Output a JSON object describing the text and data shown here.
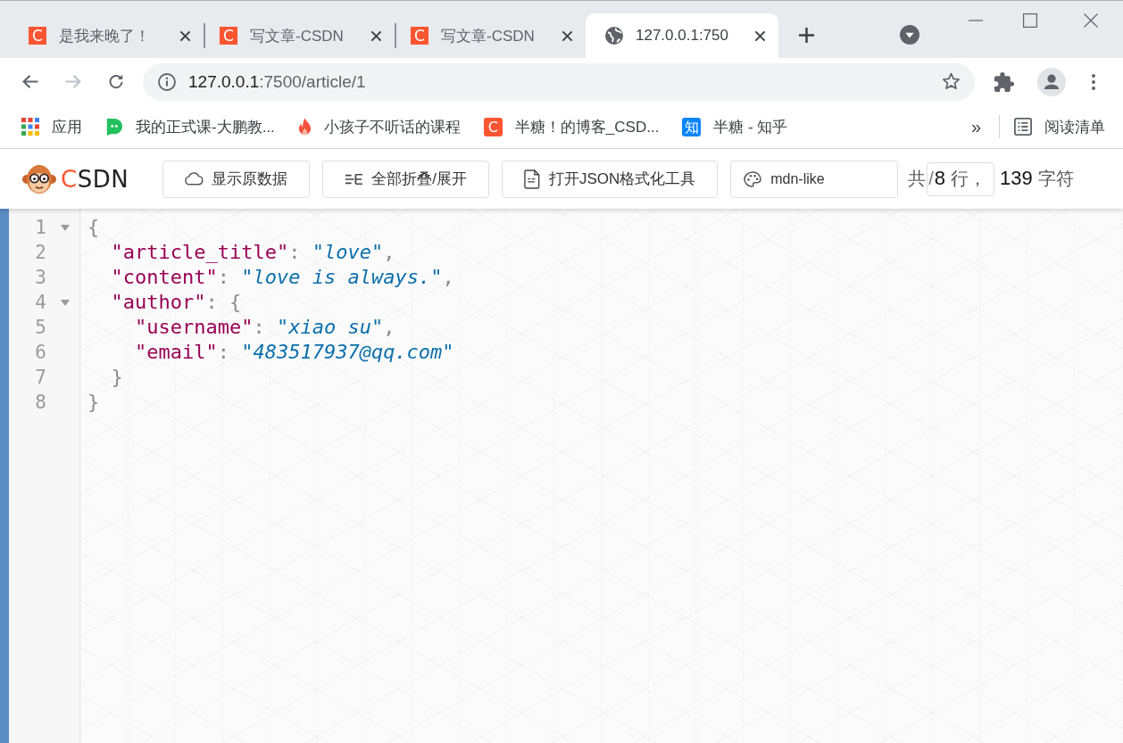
{
  "tabs": [
    {
      "title": "是我来晚了！",
      "kind": "letter",
      "icon_text": "C",
      "color": "#fc5531",
      "selected": false
    },
    {
      "title": "写文章-CSDN",
      "kind": "letter",
      "icon_text": "C",
      "color": "#fc5531",
      "selected": false
    },
    {
      "title": "写文章-CSDN",
      "kind": "letter",
      "icon_text": "C",
      "color": "#fc5531",
      "selected": false
    },
    {
      "title": "127.0.0.1:750",
      "kind": "globe",
      "selected": true
    }
  ],
  "nav_buttons": [
    {
      "kind": "back",
      "disabled": false
    },
    {
      "kind": "forward",
      "disabled": true
    },
    {
      "kind": "reload",
      "disabled": false
    }
  ],
  "address_bar": {
    "host": "127.0.0.1",
    "path": ":7500/article/1"
  },
  "bookmarks": [
    {
      "label": "应用",
      "kind": "apps"
    },
    {
      "label": "我的正式课-大鹏教...",
      "kind": "chat"
    },
    {
      "label": "小孩子不听话的课程",
      "kind": "flame"
    },
    {
      "label": "半糖！的博客_CSD...",
      "kind": "letter",
      "icon_text": "C",
      "color": "#fc5531"
    },
    {
      "label": "半糖 - 知乎",
      "kind": "letter",
      "icon_text": "知",
      "color": "#0b84ff"
    }
  ],
  "bookmarks_overflow": "»",
  "reading_list": {
    "label": "阅读清单"
  },
  "json_viewer": {
    "logo_text": "CSDN",
    "buttons": [
      {
        "label": "显示原数据",
        "kind": "cloud"
      },
      {
        "label": "全部折叠/展开",
        "kind": "lines"
      },
      {
        "label": "打开JSON格式化工具",
        "kind": "document"
      }
    ],
    "theme_select": {
      "value": "mdn-like"
    },
    "stats": {
      "label": "共",
      "boxed_parts": [
        {
          "text": "/",
          "kind": "slash"
        },
        {
          "text": "8",
          "kind": "number"
        },
        {
          "text": "行，",
          "kind": "label"
        }
      ],
      "after_parts": [
        {
          "text": "139",
          "kind": "number"
        },
        {
          "text": "字符",
          "kind": "label"
        }
      ]
    }
  },
  "editor": {
    "lines": [
      {
        "number": "1",
        "expanded": true,
        "tokens": [
          {
            "kind": "punct",
            "text": "{"
          }
        ],
        "children": [
          {
            "number": "2",
            "tokens": [
              {
                "kind": "key",
                "text": "\"article_title\""
              },
              {
                "kind": "punct",
                "text": ": "
              },
              {
                "kind": "string",
                "text": "\"love\""
              },
              {
                "kind": "punct",
                "text": ","
              }
            ]
          },
          {
            "number": "3",
            "tokens": [
              {
                "kind": "key",
                "text": "\"content\""
              },
              {
                "kind": "punct",
                "text": ": "
              },
              {
                "kind": "string",
                "text": "\"love is always.\""
              },
              {
                "kind": "punct",
                "text": ","
              }
            ]
          },
          {
            "number": "4",
            "expanded": true,
            "tokens": [
              {
                "kind": "key",
                "text": "\"author\""
              },
              {
                "kind": "punct",
                "text": ": {"
              }
            ],
            "children": [
              {
                "number": "5",
                "tokens": [
                  {
                    "kind": "key",
                    "text": "\"username\""
                  },
                  {
                    "kind": "punct",
                    "text": ": "
                  },
                  {
                    "kind": "string",
                    "text": "\"xiao su\""
                  },
                  {
                    "kind": "punct",
                    "text": ","
                  }
                ]
              },
              {
                "number": "6",
                "tokens": [
                  {
                    "kind": "key",
                    "text": "\"email\""
                  },
                  {
                    "kind": "punct",
                    "text": ": "
                  },
                  {
                    "kind": "string",
                    "text": "\"483517937@qq.com\""
                  }
                ]
              }
            ]
          },
          {
            "number": "7",
            "tokens": [
              {
                "kind": "punct",
                "text": "}"
              }
            ]
          }
        ]
      },
      {
        "number": "8",
        "tokens": [
          {
            "kind": "punct",
            "text": "}"
          }
        ]
      }
    ]
  }
}
